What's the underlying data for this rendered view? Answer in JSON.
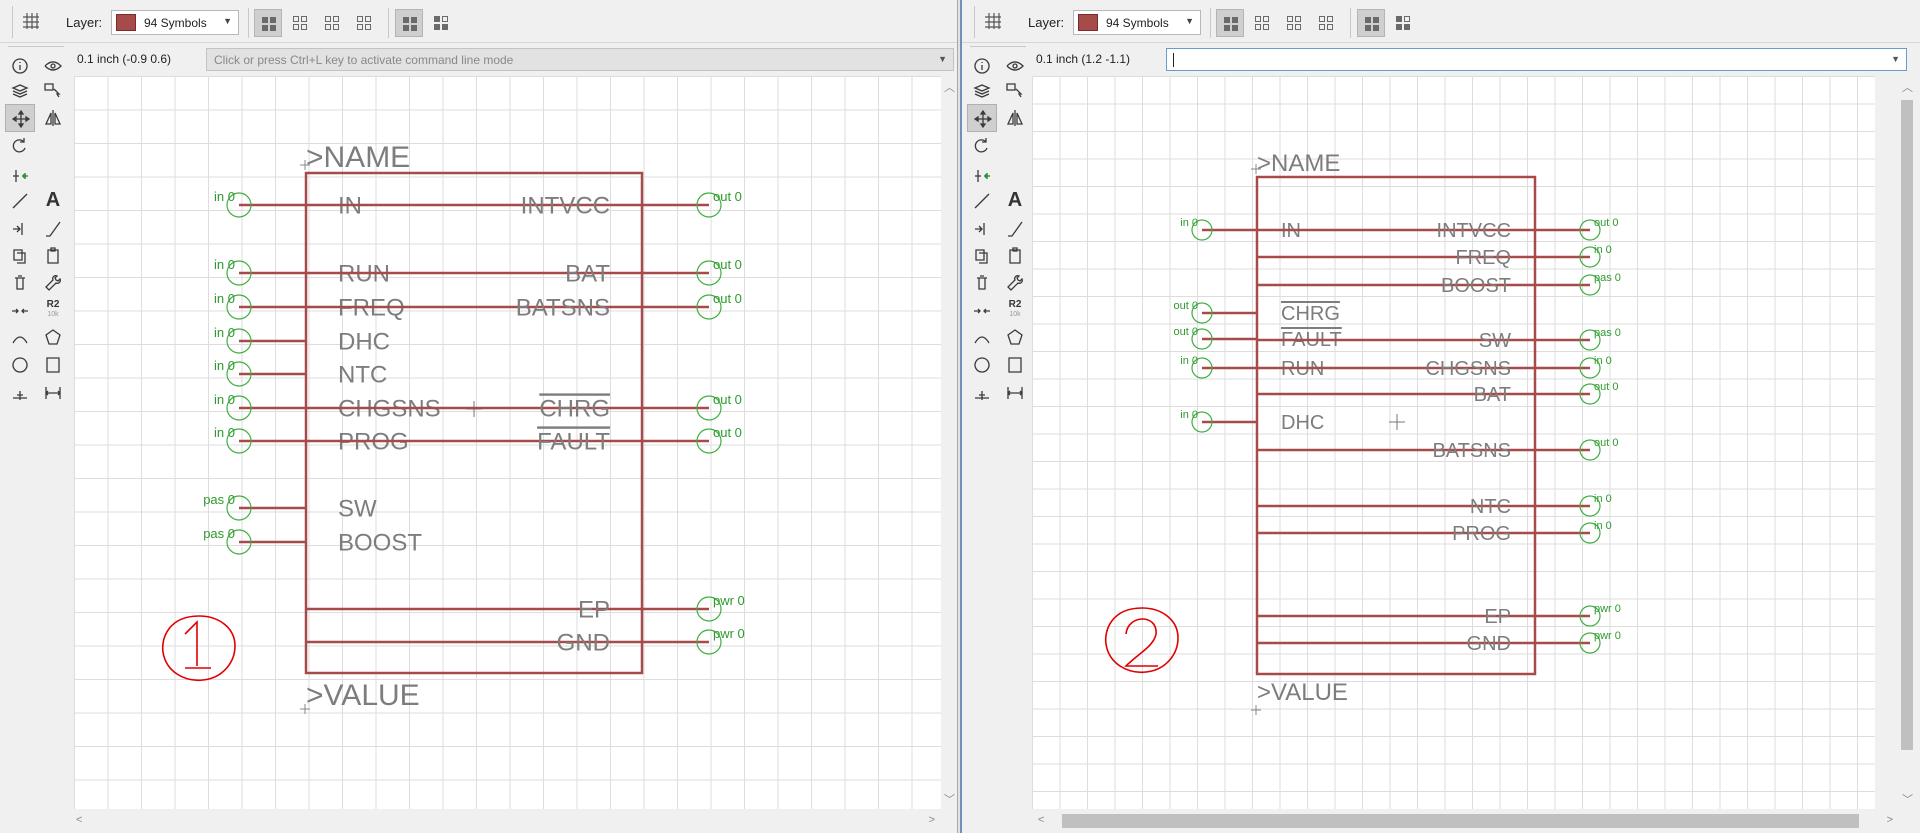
{
  "panes": [
    {
      "toolbar": {
        "layer_label": "Layer:",
        "layer_name": "94 Symbols",
        "layer_color": "#a74a4a"
      },
      "command": {
        "coords": "0.1 inch (-0.9 0.6)",
        "placeholder": "Click or press Ctrl+L key to activate command line mode",
        "value": ""
      },
      "symbol": {
        "name_label": ">NAME",
        "value_label": ">VALUE",
        "left_pins": [
          {
            "label": "IN",
            "dir": "in 0",
            "overbar": false
          },
          {
            "label": "RUN",
            "dir": "in 0",
            "overbar": false
          },
          {
            "label": "FREQ",
            "dir": "in 0",
            "overbar": false
          },
          {
            "label": "DHC",
            "dir": "in 0",
            "overbar": false
          },
          {
            "label": "NTC",
            "dir": "in 0",
            "overbar": false
          },
          {
            "label": "CHGSNS",
            "dir": "in 0",
            "overbar": false
          },
          {
            "label": "PROG",
            "dir": "in 0",
            "overbar": false
          },
          {
            "label": "SW",
            "dir": "pas 0",
            "overbar": false
          },
          {
            "label": "BOOST",
            "dir": "pas 0",
            "overbar": false
          }
        ],
        "right_pins": [
          {
            "label": "INTVCC",
            "dir": "out 0",
            "overbar": false
          },
          {
            "label": "BAT",
            "dir": "out 0",
            "overbar": false
          },
          {
            "label": "BATSNS",
            "dir": "out 0",
            "overbar": false
          },
          {
            "label": "CHRG",
            "dir": "out 0",
            "overbar": true
          },
          {
            "label": "FAULT",
            "dir": "out 0",
            "overbar": true
          },
          {
            "label": "EP",
            "dir": "pwr 0",
            "overbar": false
          },
          {
            "label": "GND",
            "dir": "pwr 0",
            "overbar": false
          }
        ],
        "annotation": "1"
      }
    },
    {
      "toolbar": {
        "layer_label": "Layer:",
        "layer_name": "94 Symbols",
        "layer_color": "#a74a4a"
      },
      "command": {
        "coords": "0.1 inch (1.2 -1.1)",
        "placeholder": "",
        "value": ""
      },
      "symbol": {
        "name_label": ">NAME",
        "value_label": ">VALUE",
        "left_pins": [
          {
            "label": "IN",
            "dir": "in 0",
            "overbar": false
          },
          {
            "label": "CHRG",
            "dir": "out 0",
            "overbar": true
          },
          {
            "label": "FAULT",
            "dir": "out 0",
            "overbar": true
          },
          {
            "label": "RUN",
            "dir": "in 0",
            "overbar": false
          },
          {
            "label": "DHC",
            "dir": "in 0",
            "overbar": false
          }
        ],
        "right_pins": [
          {
            "label": "INTVCC",
            "dir": "out 0",
            "overbar": false
          },
          {
            "label": "FREQ",
            "dir": "in 0",
            "overbar": false
          },
          {
            "label": "BOOST",
            "dir": "pas 0",
            "overbar": false
          },
          {
            "label": "SW",
            "dir": "pas 0",
            "overbar": false
          },
          {
            "label": "CHGSNS",
            "dir": "in 0",
            "overbar": false
          },
          {
            "label": "BAT",
            "dir": "out 0",
            "overbar": false
          },
          {
            "label": "BATSNS",
            "dir": "out 0",
            "overbar": false
          },
          {
            "label": "NTC",
            "dir": "in 0",
            "overbar": false
          },
          {
            "label": "PROG",
            "dir": "in 0",
            "overbar": false
          },
          {
            "label": "EP",
            "dir": "pwr 0",
            "overbar": false
          },
          {
            "label": "GND",
            "dir": "pwr 0",
            "overbar": false
          }
        ],
        "annotation": "2"
      }
    }
  ],
  "toolbox": {
    "value_tool_label": "R2",
    "value_tool_sub": "10k",
    "text_tool_label": "A"
  },
  "colors": {
    "symbol_outline": "#a74a4a",
    "pin_ring": "#3fae3f",
    "pin_text": "#2e9a2e",
    "label_text": "#7d7d7d",
    "annotation_ink": "#e00000"
  }
}
